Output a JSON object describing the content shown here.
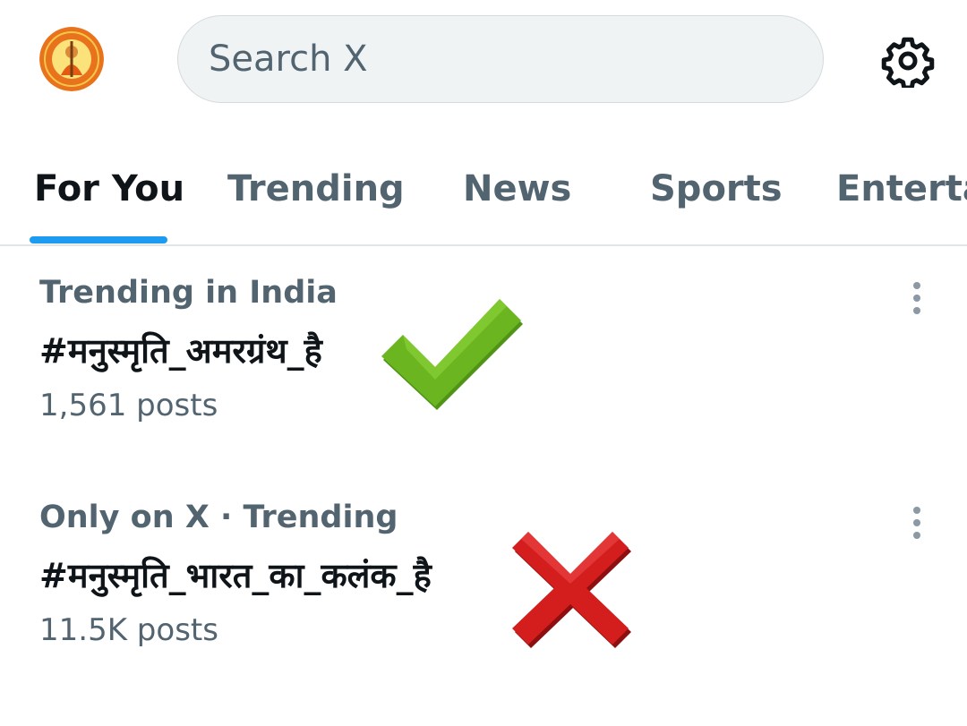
{
  "header": {
    "search_placeholder": "Search X",
    "avatar_icon": "voice-of-brahmins-logo",
    "settings_icon": "gear-icon"
  },
  "tabs": [
    {
      "label": "For You",
      "active": true
    },
    {
      "label": "Trending",
      "active": false
    },
    {
      "label": "News",
      "active": false
    },
    {
      "label": "Sports",
      "active": false
    },
    {
      "label": "Enterta",
      "active": false
    }
  ],
  "trends": [
    {
      "context": "Trending in India",
      "name": "#मनुस्मृति_अमरग्रंथ_है",
      "posts": "1,561 posts",
      "annotation_icon": "green-check-icon"
    },
    {
      "context": "Only on X · Trending",
      "name": "#मनुस्मृति_भारत_का_कलंक_है",
      "posts": "11.5K posts",
      "annotation_icon": "red-cross-icon"
    }
  ],
  "colors": {
    "accent": "#1d9bf0",
    "primary_text": "#0f1419",
    "secondary_text": "#536471",
    "search_bg": "#eff3f4",
    "check_green": "#6ab520",
    "cross_red": "#d41d1d"
  }
}
